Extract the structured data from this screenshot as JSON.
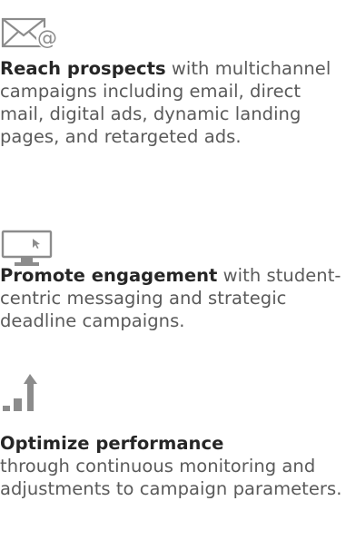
{
  "features": [
    {
      "icon": "email-at-icon",
      "lead": "Reach prospects",
      "text": "multichannel campaigns including email, direct mail, digital ads, dynamic landing pages, and retargeted ads.",
      "connector": "with"
    },
    {
      "icon": "monitor-cursor-icon",
      "lead": "Promote engagement",
      "text": "student-centric messaging and strategic deadline campaigns.",
      "connector": "with"
    },
    {
      "icon": "growth-bars-icon",
      "lead": "Optimize performance",
      "text": "through continuous monitoring and adjustments to campaign parameters.",
      "connector": ""
    }
  ],
  "colors": {
    "text": "#5a5a5a",
    "lead": "#262626",
    "icon": "#8c8c8c"
  }
}
